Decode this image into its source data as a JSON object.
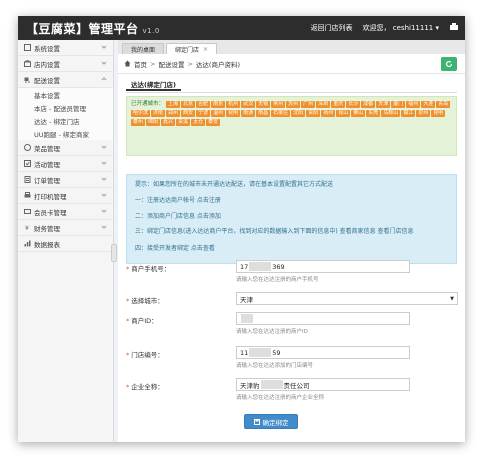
{
  "app": {
    "title": "【豆腐菜】管理平台",
    "version": "v1.0",
    "top_links": [
      "返回门店列表",
      "欢迎您，",
      "ceshi11111"
    ]
  },
  "sidebar": {
    "items": [
      {
        "label": "系统设置",
        "icon": "system-settings-icon"
      },
      {
        "label": "店内设置",
        "icon": "store-settings-icon"
      },
      {
        "label": "配送设置",
        "icon": "delivery-settings-icon",
        "expanded": true
      },
      {
        "label": "菜品管理",
        "icon": "dish-icon"
      },
      {
        "label": "活动管理",
        "icon": "activity-icon"
      },
      {
        "label": "订单管理",
        "icon": "order-icon"
      },
      {
        "label": "打印机管理",
        "icon": "printer-icon"
      },
      {
        "label": "会员卡管理",
        "icon": "membership-card-icon"
      },
      {
        "label": "财务管理",
        "icon": "finance-icon"
      },
      {
        "label": "数据报表",
        "icon": "report-icon"
      }
    ],
    "submenu": [
      "基本设置",
      "本店 - 配送员管理",
      "达达 - 绑定门店",
      "UU跑腿 - 绑定商家"
    ]
  },
  "tabs": [
    {
      "label": "我的桌面",
      "active": false
    },
    {
      "label": "绑定门店",
      "active": true
    }
  ],
  "breadcrumb": [
    "首页",
    "配送设置",
    "达达(商户资料)"
  ],
  "panel": {
    "title": "达达(绑定门店)"
  },
  "cities": {
    "label": "已开通城市：",
    "list": [
      "上海",
      "北京",
      "合肥",
      "南京",
      "杭州",
      "武汉",
      "无锡",
      "常州",
      "苏州",
      "广州",
      "深圳",
      "重庆",
      "长沙",
      "成都",
      "天津",
      "厦门",
      "福州",
      "大连",
      "青岛",
      "哈尔滨",
      "济南",
      "郑州",
      "西安",
      "宁波",
      "温州",
      "昆明",
      "南通",
      "南昌",
      "石家庄",
      "沈阳",
      "贵阳",
      "扬州",
      "昆山",
      "佛山",
      "东莞",
      "马鞍山",
      "镇江",
      "泉州",
      "昆明",
      "泰州",
      "绵阳",
      "嘉兴",
      "贵溪",
      "太仓",
      "泰安"
    ]
  },
  "info": {
    "title": "提示：如果您所在的城市未开通达达配送，请在基本设置配置其它方式配送",
    "steps": [
      "一：注册达达商户帐号 点击注册",
      "二：添加商户门店信息 点击添加",
      "三：绑定门店信息(进入达达商户平台，找到对应的数据输入到下面的信息中) 查看商家信息 查看门店信息",
      "四：接受开发者绑定 点击查看"
    ]
  },
  "form": {
    "phone": {
      "label": "商户手机号：",
      "value_prefix": "17",
      "value_suffix": "369",
      "help": "请输入您在达达注册的商户手机号"
    },
    "city": {
      "label": "选择城市：",
      "value": "天津"
    },
    "merchant_id": {
      "label": "商户ID：",
      "value": "",
      "help": "请输入您在达达注册的商户ID"
    },
    "store_no": {
      "label": "门店编号：",
      "value_prefix": "11",
      "value_suffix": "59",
      "help": "请输入您在达达添加的门店编号"
    },
    "company": {
      "label": "企业全称：",
      "value_prefix": "天津豹",
      "value_suffix": "责任公司",
      "help": "请输入您在达达注册的商户企业全称"
    },
    "submit_label": "确定绑定"
  },
  "colors": {
    "topbar": "#2d2d2d",
    "city_tag": "#f0902c",
    "info_bg": "#d9edf7",
    "cities_bg": "#e4f3d7",
    "submit": "#428bca",
    "refresh": "#3cb371"
  }
}
